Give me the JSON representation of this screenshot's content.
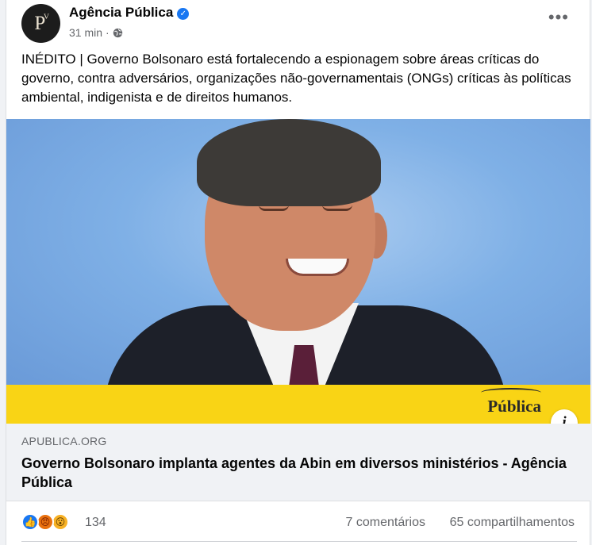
{
  "page": {
    "name": "Agência Pública",
    "avatar_text": "P",
    "time": "31 min"
  },
  "post": {
    "text": "INÉDITO | Governo Bolsonaro está fortalecendo a espionagem sobre áreas críticas do governo, contra adversários, organizações não-governamentais (ONGs) críticas às políticas ambiental, indigenista e de direitos humanos."
  },
  "link": {
    "image_logo": "Pública",
    "domain": "APUBLICA.ORG",
    "title": "Governo Bolsonaro implanta agentes da Abin em diversos ministérios - Agência Pública"
  },
  "footer": {
    "reaction_count": "134",
    "comments": "7 comentários",
    "shares": "65 compartilhamentos"
  },
  "icons": {
    "verified": "verified-badge-icon",
    "globe": "globe-icon",
    "more": "more-options-icon",
    "info": "info-icon",
    "reactions": [
      "like-icon",
      "angry-icon",
      "wow-icon"
    ]
  },
  "colors": {
    "brand_blue": "#1877f2",
    "banner_yellow": "#f9d415",
    "meta_gray": "#65676b"
  }
}
